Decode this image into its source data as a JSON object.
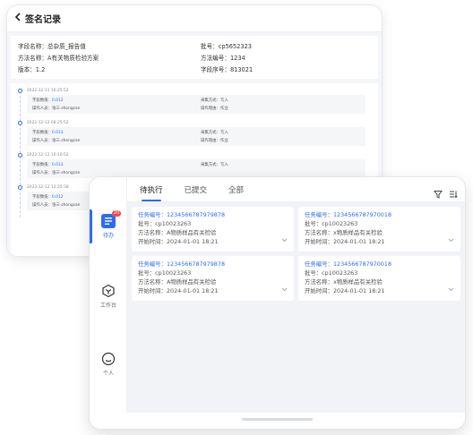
{
  "back_screen": {
    "back_icon": "chevron-left-icon",
    "title": "签名记录",
    "info": {
      "field_name": "字段名称：总杂质_报告值",
      "batch_no": "批号：cp5652323",
      "method_name": "方法名称：A有关物质检验方案",
      "method_no": "方法编号：1234",
      "version": "版本：1.2",
      "field_seq": "字段序号：813021"
    },
    "entries": [
      {
        "time": "2022-12-11  16:25:52",
        "value_label": "字段数值：",
        "value": "0.012",
        "user": "操作人员：张三-zhongsan",
        "method": "采集方式：写入",
        "reason": "操作理由：作业"
      },
      {
        "time": "2022-12-12  08:25:52",
        "value_label": "字段数值：",
        "value": "0.013",
        "user": "操作人员：张三-zhongsan",
        "method": "采集方式：写入",
        "reason": "操作理由：作业"
      },
      {
        "time": "2022-12-12  10:10:52",
        "value_label": "字段数值：",
        "value": "0.013",
        "user": "操作人员：张三-zhongsan",
        "method": "采集方式：写入",
        "reason": ""
      },
      {
        "time": "2022-12-12  12:25:38",
        "value_label": "字段数值：",
        "value": "0.012",
        "user": "操作人员：张三-zhongsan",
        "method": "",
        "reason": ""
      }
    ]
  },
  "front_screen": {
    "sidebar": {
      "todo": {
        "label": "待办",
        "badge": "20",
        "icon": "todo-list-icon"
      },
      "workbench": {
        "label": "工作台",
        "icon": "workbench-icon"
      },
      "profile": {
        "label": "个人",
        "icon": "smile-user-icon"
      }
    },
    "tabs": [
      "待执行",
      "已提交",
      "全部"
    ],
    "active_tab": "待执行",
    "tools": {
      "filter_icon": "filter-icon",
      "sort_icon": "sort-icon"
    },
    "tasks": [
      {
        "task_no_label": "任务编号：",
        "task_no": "1234566787979878",
        "batch": "批号：cp10023263",
        "method": "方法名称：A物质样品有关检验",
        "start": "开始时间：2024-01-01  18:21"
      },
      {
        "task_no_label": "任务编号：",
        "task_no": "1234566787970018",
        "batch": "批号：cp10023263",
        "method": "方法名称：x物质样品有关检验",
        "start": "开始时间：2024-01-01  18:21"
      },
      {
        "task_no_label": "任务编号：",
        "task_no": "1234566787979878",
        "batch": "批号：cp10023263",
        "method": "方法名称：A物质样品有关检验",
        "start": "开始时间：2024-01-01  18:21"
      },
      {
        "task_no_label": "任务编号：",
        "task_no": "1234566787970018",
        "batch": "批号：cp10023263",
        "method": "方法名称：x物质样品有关检验",
        "start": "开始时间：2024-01-01  18:21"
      }
    ]
  },
  "colors": {
    "accent": "#2d6cf2",
    "badge": "#f5484a",
    "panel_bg": "#f1f3f6"
  }
}
